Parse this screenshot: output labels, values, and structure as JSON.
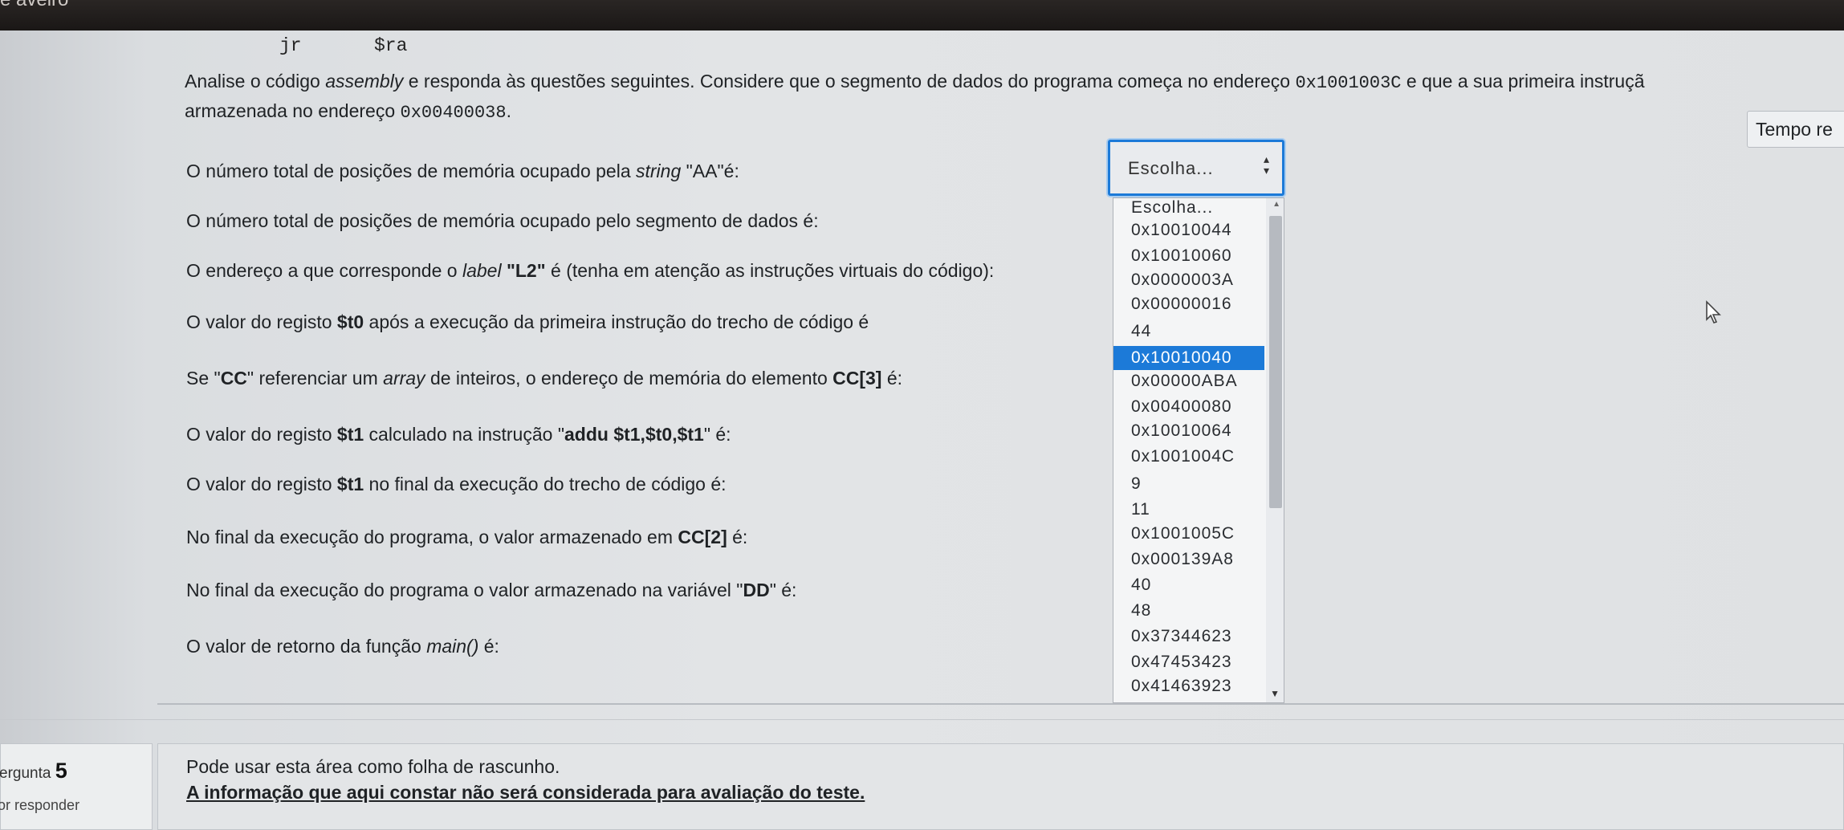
{
  "browser": {
    "title_fragment": "e aveiro"
  },
  "code": {
    "instruction": "jr",
    "operand": "$ra"
  },
  "intro": {
    "line1_a": "Analise o código ",
    "line1_em": "assembly",
    "line1_b": " e responda às questões seguintes. Considere que o segmento de dados do programa começa no endereço ",
    "line1_addr": "0x1001003C",
    "line1_c": " e que a sua primeira instruçã",
    "line2_a": "armazenada no endereço ",
    "line2_addr": "0x00400038",
    "line2_b": "."
  },
  "timer": {
    "label": "Tempo re"
  },
  "questions": [
    {
      "pre": "O número total de posições de memória ocupado pela ",
      "it": "string",
      "post": " \"AA\"é:"
    },
    {
      "text": "O número total de posições de memória ocupado pelo segmento de dados é:"
    },
    {
      "pre": "O endereço a que corresponde o ",
      "it": "label",
      "b": " \"L2\"",
      "post": " é (tenha em atenção as instruções virtuais do código):"
    },
    {
      "pre": "O valor do registo ",
      "b": "$t0",
      "post": " após a execução da primeira instrução do trecho de código é"
    },
    {
      "pre": "Se \"",
      "b1": "CC",
      "mid": "\" referenciar um ",
      "it": "array",
      "mid2": " de inteiros, o endereço de memória do elemento ",
      "b2": "CC[3]",
      "post": " é:"
    },
    {
      "pre": "O valor do registo ",
      "b1": "$t1",
      "mid": " calculado na instrução \"",
      "b2": "addu  $t1,$t0,$t1",
      "post": "\" é:"
    },
    {
      "pre": "O valor do registo ",
      "b": "$t1",
      "post": " no final da execução do trecho de código é:"
    },
    {
      "pre": "No final da execução do programa, o valor armazenado em ",
      "b": "CC[2]",
      "post": " é:"
    },
    {
      "pre": "No final da execução do programa o valor armazenado na variável \"",
      "b": "DD",
      "post": "\" é:"
    },
    {
      "pre": "O valor de retorno da função ",
      "it": "main()",
      "post": " é:"
    }
  ],
  "select": {
    "value": "Escolha..."
  },
  "dropdown": {
    "options": [
      "Escolha...",
      "0x10010044",
      "0x10010060",
      "0x0000003A",
      "0x00000016",
      "44",
      "0x10010040",
      "0x00000ABA",
      "0x00400080",
      "0x10010064",
      "0x1001004C",
      "9",
      "11",
      "0x1001005C",
      "0x000139A8",
      "40",
      "48",
      "0x37344623",
      "0x47453423",
      "0x41463923"
    ],
    "selected": "0x10010040"
  },
  "question5": {
    "label": "ergunta",
    "number": "5",
    "status": "or responder",
    "note": "Pode usar esta área como folha de rascunho.",
    "warning": "A informação que aqui constar não será considerada para avaliação do teste."
  }
}
